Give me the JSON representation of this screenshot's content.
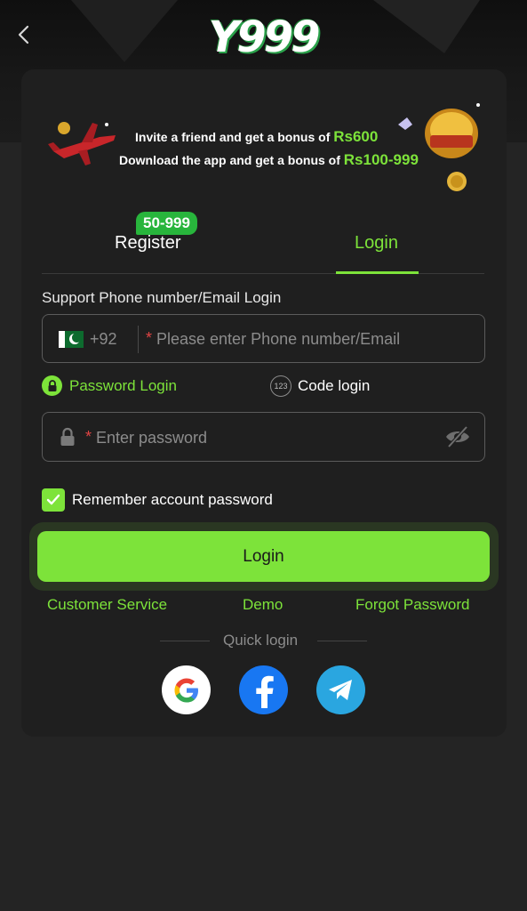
{
  "brand": {
    "logo_text": "Y999",
    "accent": "#7de33a"
  },
  "banner": {
    "invite_text": "Invite a friend and get a bonus of",
    "invite_amount": "Rs600",
    "download_text": "Download the app and get a bonus of",
    "download_amount": "Rs100-999"
  },
  "tabs": {
    "register_label": "Register",
    "register_badge": "50-999",
    "login_label": "Login",
    "active": "Login"
  },
  "form": {
    "support_label": "Support Phone number/Email Login",
    "country_code": "+92",
    "phone_placeholder": "Please enter Phone number/Email",
    "password_login_label": "Password Login",
    "code_badge": "123",
    "code_login_label": "Code login",
    "password_placeholder": "Enter password",
    "remember_label": "Remember account password",
    "remember_checked": true,
    "login_button": "Login"
  },
  "links": {
    "customer_service": "Customer Service",
    "demo": "Demo",
    "forgot_password": "Forgot Password"
  },
  "quick_login": {
    "label": "Quick login",
    "providers": [
      "google",
      "facebook",
      "telegram"
    ]
  }
}
